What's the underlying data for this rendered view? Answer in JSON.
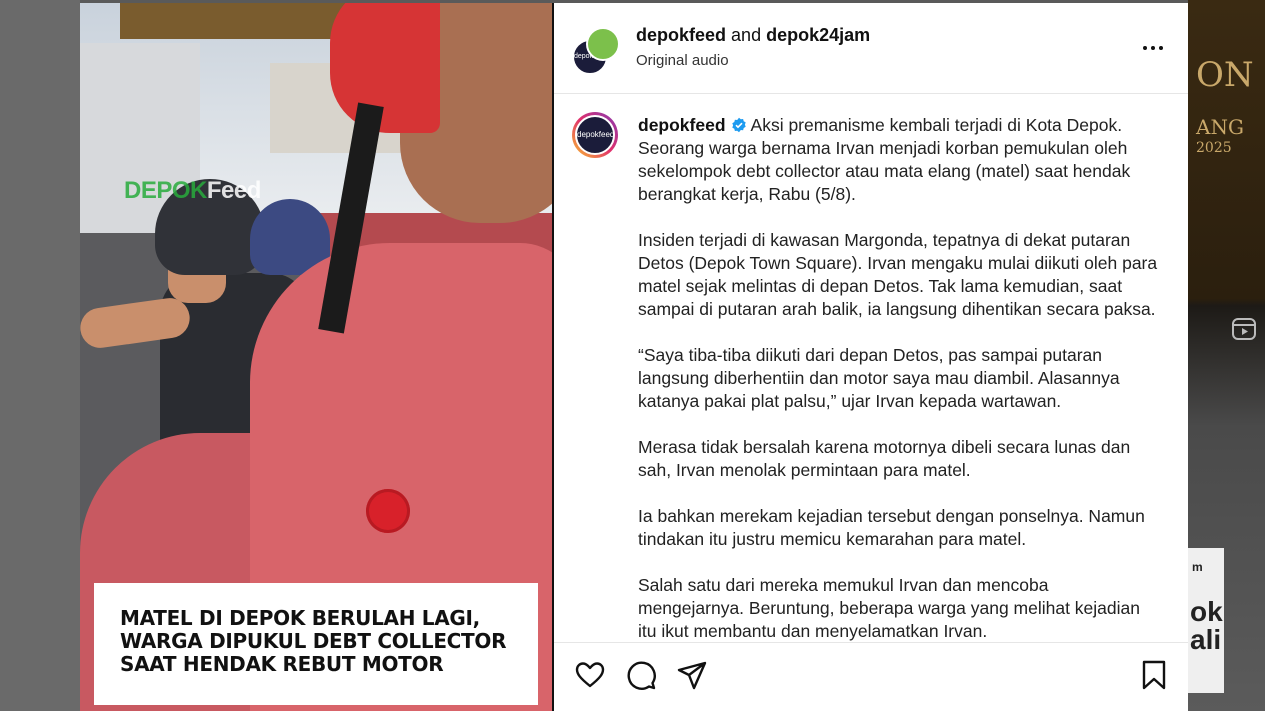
{
  "background": {
    "right_text_1": "ON",
    "right_text_2": "ANG",
    "right_text_3": "2025",
    "right_card_1": "m",
    "right_card_2": "ok",
    "right_card_3": "ali",
    "reels_icon": "reels-icon"
  },
  "media": {
    "watermark_part1": "DEPOK",
    "watermark_part2": "Feed",
    "caption_lines": [
      "MATEL DI DEPOK BERULAH LAGI,",
      "WARGA DIPUKUL DEBT COLLECTOR",
      "SAAT HENDAK REBUT MOTOR"
    ]
  },
  "header": {
    "user1": "depokfeed",
    "joiner": "and",
    "user2": "depok24jam",
    "audio": "Original audio",
    "avatar_label": "depokfeed",
    "avatar_badge": "DEPOK"
  },
  "caption": {
    "username": "depokfeed",
    "avatar_label": "depokfeed",
    "paragraphs": [
      "Aksi premanisme kembali terjadi di Kota Depok. Seorang warga bernama Irvan menjadi korban pemukulan oleh sekelompok debt collector atau mata elang (matel) saat hendak berangkat kerja, Rabu (5/8).",
      "Insiden terjadi di kawasan Margonda, tepatnya di dekat putaran Detos (Depok Town Square). Irvan mengaku mulai diikuti oleh para matel sejak melintas di depan Detos. Tak lama kemudian, saat sampai di putaran arah balik, ia langsung dihentikan secara paksa.",
      "“Saya tiba-tiba diikuti dari depan Detos, pas sampai putaran langsung diberhentiin dan motor saya mau diambil. Alasannya katanya pakai plat palsu,” ujar Irvan kepada wartawan.",
      "Merasa tidak bersalah karena motornya dibeli secara lunas dan sah, Irvan menolak permintaan para matel.",
      "Ia bahkan merekam kejadian tersebut dengan ponselnya. Namun tindakan itu justru memicu kemarahan para matel.",
      "Salah satu dari mereka memukul Irvan dan mencoba mengejarnya. Beruntung, beberapa warga yang melihat kejadian itu ikut membantu dan menyelamatkan Irvan."
    ]
  },
  "actions": {
    "like": "heart-icon",
    "comment": "comment-icon",
    "share": "share-icon",
    "save": "bookmark-icon"
  },
  "colors": {
    "verified": "#1d9bf0",
    "panel_bg": "#ffffff",
    "text": "#222222"
  }
}
